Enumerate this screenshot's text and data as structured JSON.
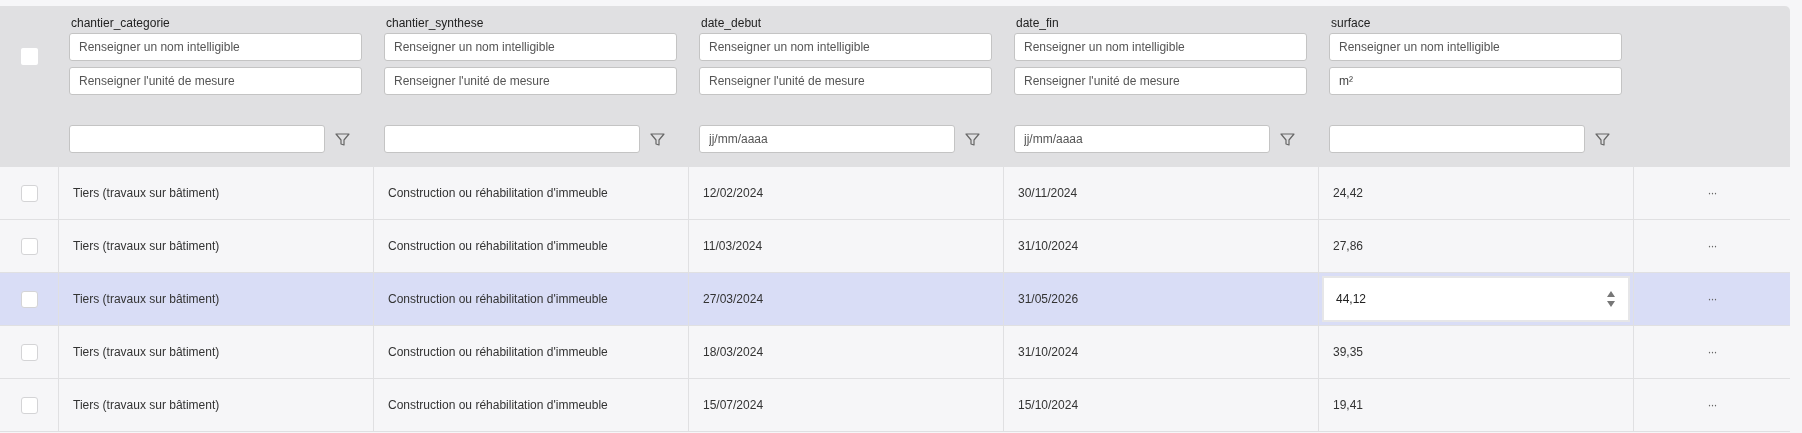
{
  "header": {
    "select_all": {
      "checked": false
    },
    "columns": [
      {
        "name": "chantier_categorie",
        "label_field": {
          "placeholder": "Renseigner un nom intelligible"
        },
        "unit_field": {
          "placeholder": "Renseigner l'unité de mesure"
        }
      },
      {
        "name": "chantier_synthese",
        "label_field": {
          "placeholder": "Renseigner un nom intelligible"
        },
        "unit_field": {
          "placeholder": "Renseigner l'unité de mesure"
        }
      },
      {
        "name": "date_debut",
        "label_field": {
          "placeholder": "Renseigner un nom intelligible"
        },
        "unit_field": {
          "placeholder": "Renseigner l'unité de mesure"
        },
        "filter_field": {
          "placeholder": "jj/mm/aaaa"
        }
      },
      {
        "name": "date_fin",
        "label_field": {
          "placeholder": "Renseigner un nom intelligible"
        },
        "unit_field": {
          "placeholder": "Renseigner l'unité de mesure"
        },
        "filter_field": {
          "placeholder": "jj/mm/aaaa"
        }
      },
      {
        "name": "surface",
        "label_field": {
          "placeholder": "Renseigner un nom intelligible"
        },
        "unit_field": {
          "value": "m²"
        }
      }
    ]
  },
  "rows": [
    {
      "selected": false,
      "checked": false,
      "editing": false,
      "cells": [
        "Tiers (travaux sur bâtiment)",
        "Construction ou réhabilitation d'immeuble",
        "12/02/2024",
        "30/11/2024",
        "24,42"
      ],
      "actions": "···"
    },
    {
      "selected": false,
      "checked": false,
      "editing": false,
      "cells": [
        "Tiers (travaux sur bâtiment)",
        "Construction ou réhabilitation d'immeuble",
        "11/03/2024",
        "31/10/2024",
        "27,86"
      ],
      "actions": "···"
    },
    {
      "selected": true,
      "checked": false,
      "editing": true,
      "cells": [
        "Tiers (travaux sur bâtiment)",
        "Construction ou réhabilitation d'immeuble",
        "27/03/2024",
        "31/05/2026",
        "44,12"
      ],
      "actions": "···"
    },
    {
      "selected": false,
      "checked": false,
      "editing": false,
      "cells": [
        "Tiers (travaux sur bâtiment)",
        "Construction ou réhabilitation d'immeuble",
        "18/03/2024",
        "31/10/2024",
        "39,35"
      ],
      "actions": "···"
    },
    {
      "selected": false,
      "checked": false,
      "editing": false,
      "cells": [
        "Tiers (travaux sur bâtiment)",
        "Construction ou réhabilitation d'immeuble",
        "15/07/2024",
        "15/10/2024",
        "19,41"
      ],
      "actions": "···"
    }
  ]
}
